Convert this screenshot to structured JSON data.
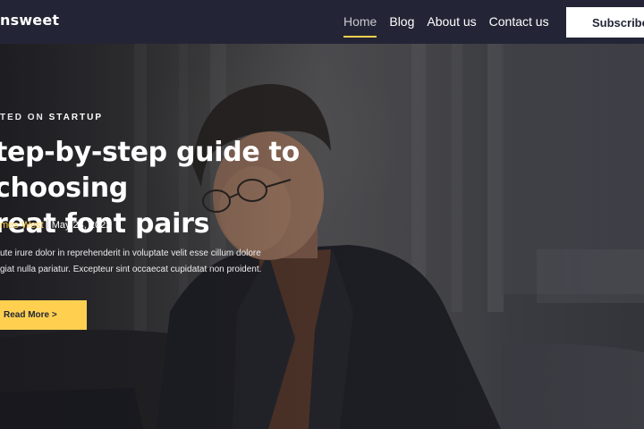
{
  "nav": {
    "logo": "nsweet",
    "links": [
      {
        "label": "Home",
        "active": true
      },
      {
        "label": "Blog",
        "active": false
      },
      {
        "label": "About us",
        "active": false
      },
      {
        "label": "Contact us",
        "active": false
      }
    ],
    "subscribe_label": "Subscribe"
  },
  "hero": {
    "posted_prefix": "TED ON ",
    "category": "STARTUP",
    "headline_line1": "tep-by-step guide to choosing",
    "headline_line2": "reat font pairs",
    "author": "mes West",
    "date": "May 23, 2022",
    "excerpt_line1": "ute irure dolor in reprehenderit in voluptate velit esse cillum dolore",
    "excerpt_line2": "giat nulla pariatur. Excepteur sint occaecat cupidatat non proident.",
    "read_more_label": "Read More >"
  },
  "colors": {
    "nav_bg": "#232536",
    "accent": "#ffd050",
    "text_light": "#ffffff"
  }
}
